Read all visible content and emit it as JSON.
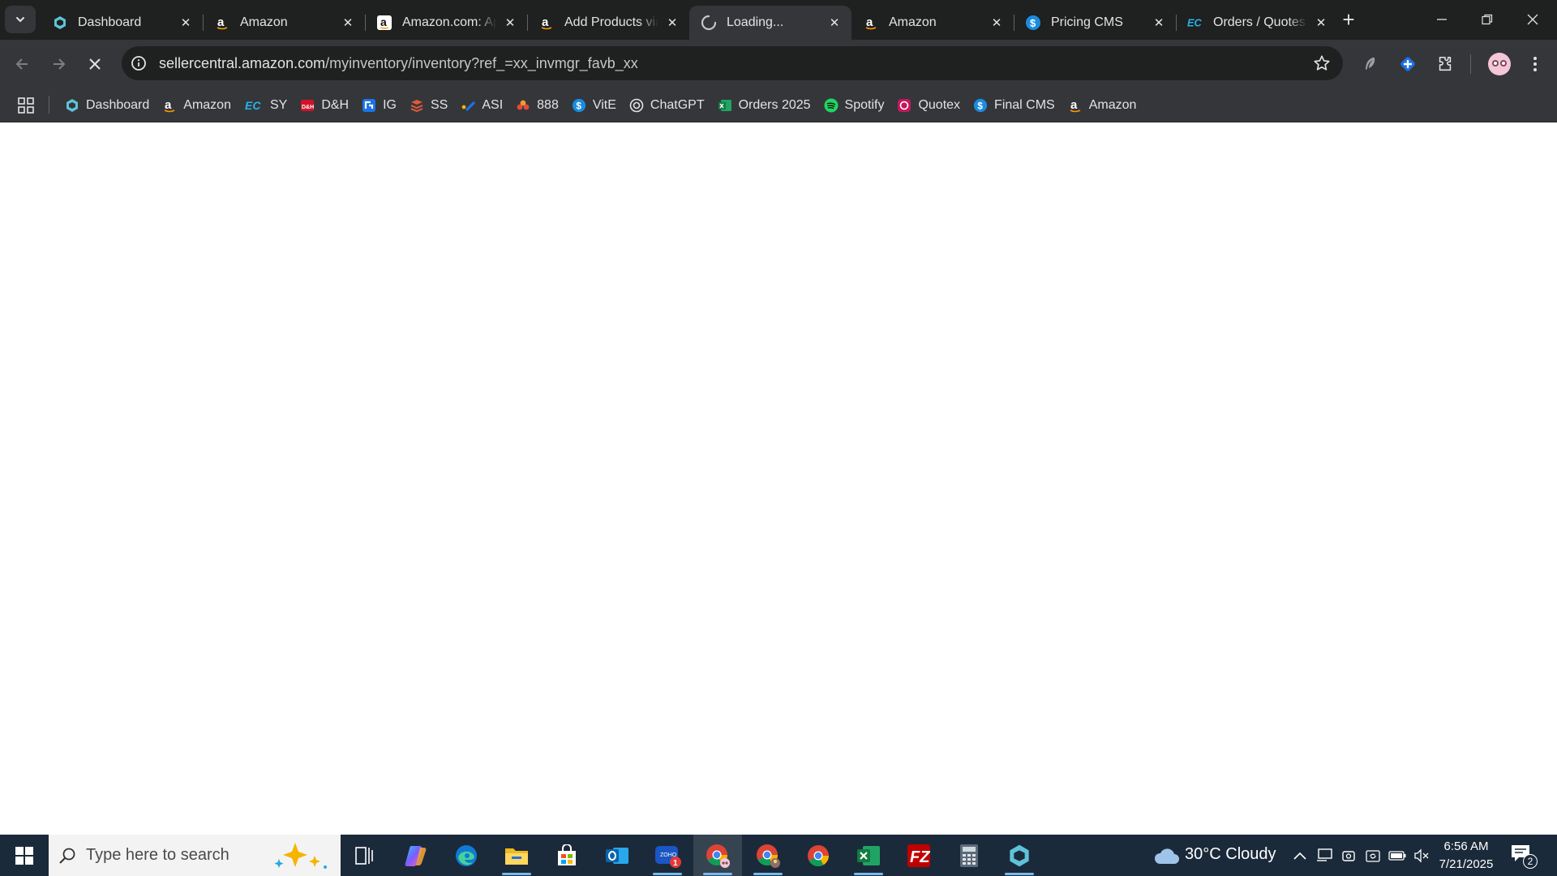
{
  "tabs": [
    {
      "title": "Dashboard",
      "icon": "hexagon-logo-icon",
      "active": false
    },
    {
      "title": "Amazon",
      "icon": "amazon-icon",
      "active": false
    },
    {
      "title": "Amazon.com: Apple",
      "icon": "amazon-icon",
      "active": false
    },
    {
      "title": "Add Products via Upload",
      "icon": "amazon-icon",
      "active": false
    },
    {
      "title": "Loading...",
      "icon": "loading-spinner-icon",
      "active": true
    },
    {
      "title": "Amazon",
      "icon": "amazon-icon",
      "active": false
    },
    {
      "title": "Pricing CMS",
      "icon": "dollar-icon",
      "active": false
    },
    {
      "title": "Orders / Quotes",
      "icon": "ec-logo-icon",
      "active": false
    }
  ],
  "address_bar": {
    "host": "sellercentral.amazon.com",
    "path": "/myinventory/inventory?ref_=xx_invmgr_favb_xx"
  },
  "bookmarks": [
    {
      "label": "Dashboard",
      "icon": "hexagon-logo-icon"
    },
    {
      "label": "Amazon",
      "icon": "amazon-icon"
    },
    {
      "label": "SY",
      "icon": "ec-logo-icon"
    },
    {
      "label": "D&H",
      "icon": "dh-logo-icon"
    },
    {
      "label": "IG",
      "icon": "ig-logo-icon"
    },
    {
      "label": "SS",
      "icon": "ss-logo-icon"
    },
    {
      "label": "ASI",
      "icon": "asi-logo-icon"
    },
    {
      "label": "888",
      "icon": "888-logo-icon"
    },
    {
      "label": "VitE",
      "icon": "dollar-icon"
    },
    {
      "label": "ChatGPT",
      "icon": "chatgpt-icon"
    },
    {
      "label": "Orders 2025",
      "icon": "excel-icon"
    },
    {
      "label": "Spotify",
      "icon": "spotify-icon"
    },
    {
      "label": "Quotex",
      "icon": "quotex-icon"
    },
    {
      "label": "Final CMS",
      "icon": "dollar-icon"
    },
    {
      "label": "Amazon",
      "icon": "amazon-icon"
    }
  ],
  "taskbar": {
    "search_placeholder": "Type here to search",
    "weather": "30°C  Cloudy",
    "time": "6:56 AM",
    "date": "7/21/2025",
    "notification_count": "2",
    "outlook_badge": "1"
  },
  "colors": {
    "tab_strip": "#1f2020",
    "toolbar": "#35363a",
    "taskbar": "#1b2a3a",
    "taskbar_indicator": "#76b9ed"
  }
}
